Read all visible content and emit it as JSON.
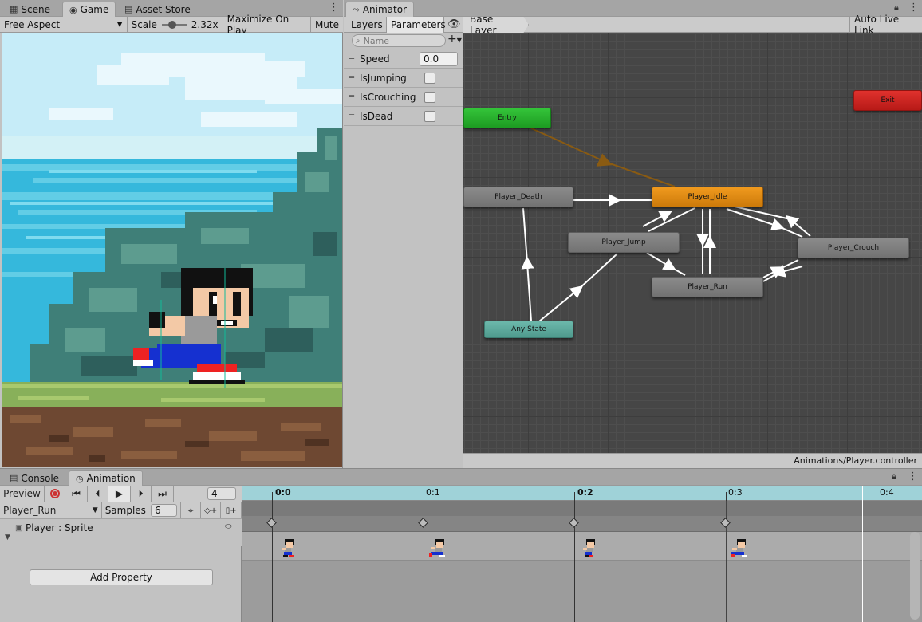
{
  "game_window": {
    "tabs": [
      {
        "label": "Scene",
        "icon": "grid-icon"
      },
      {
        "label": "Game",
        "icon": "gamepad-icon"
      },
      {
        "label": "Asset Store",
        "icon": "store-icon"
      }
    ],
    "aspect": "Free Aspect",
    "scale_label": "Scale",
    "scale_value": "2.32x",
    "maximize_label": "Maximize On Play",
    "mute_label": "Mute"
  },
  "animator": {
    "title": "Animator",
    "tabs": {
      "layers": "Layers",
      "parameters": "Parameters"
    },
    "search_placeholder": "Name",
    "breadcrumb": "Base Layer",
    "auto_live_link": "Auto Live Link",
    "parameters": [
      {
        "name": "Speed",
        "type": "float",
        "value": "0.0"
      },
      {
        "name": "IsJumping",
        "type": "bool"
      },
      {
        "name": "IsCrouching",
        "type": "bool"
      },
      {
        "name": "IsDead",
        "type": "bool"
      }
    ],
    "states": {
      "entry": "Entry",
      "exit": "Exit",
      "any": "Any State",
      "death": "Player_Death",
      "idle": "Player_Idle",
      "jump": "Player_Jump",
      "crouch": "Player_Crouch",
      "run": "Player_Run"
    },
    "controller_path": "Animations/Player.controller",
    "colors": {
      "entry": "#23a52a",
      "exit": "#c6201c",
      "default": "#e08a13",
      "any": "#5ba79a"
    }
  },
  "bottom": {
    "tabs": [
      {
        "label": "Console",
        "icon": "console-icon"
      },
      {
        "label": "Animation",
        "icon": "animation-clock-icon"
      }
    ],
    "preview_label": "Preview",
    "frame_value": "4",
    "clip_name": "Player_Run",
    "samples_label": "Samples",
    "samples_value": "6",
    "property_label": "Player : Sprite",
    "add_property": "Add Property",
    "ruler": [
      "0:0",
      "0:1",
      "0:2",
      "0:3",
      "0:4"
    ]
  }
}
